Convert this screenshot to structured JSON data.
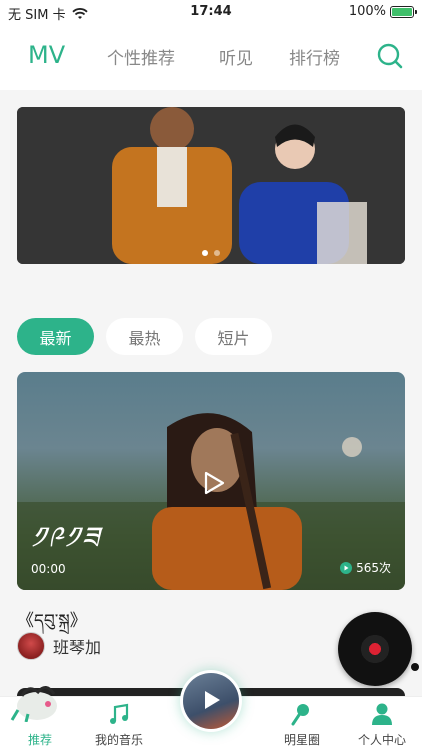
{
  "status": {
    "carrier": "无 SIM 卡",
    "time": "17:44",
    "battery": "100%"
  },
  "nav": {
    "active": "MV",
    "tabs": [
      "个性推荐",
      "听见",
      "排行榜"
    ]
  },
  "banner": {
    "slides": 2,
    "active_slide": 1
  },
  "filters": [
    "最新",
    "最热",
    "短片"
  ],
  "video": {
    "overlay_title": "༡༩༡ཟ",
    "time": "00:00",
    "views": "565次",
    "title": "《དབུ་སྐྲ》",
    "artist": "班琴加"
  },
  "tabbar": {
    "items": [
      "推荐",
      "我的音乐",
      "明星圈",
      "个人中心"
    ],
    "active": "推荐"
  },
  "colors": {
    "accent": "#2db38a"
  }
}
